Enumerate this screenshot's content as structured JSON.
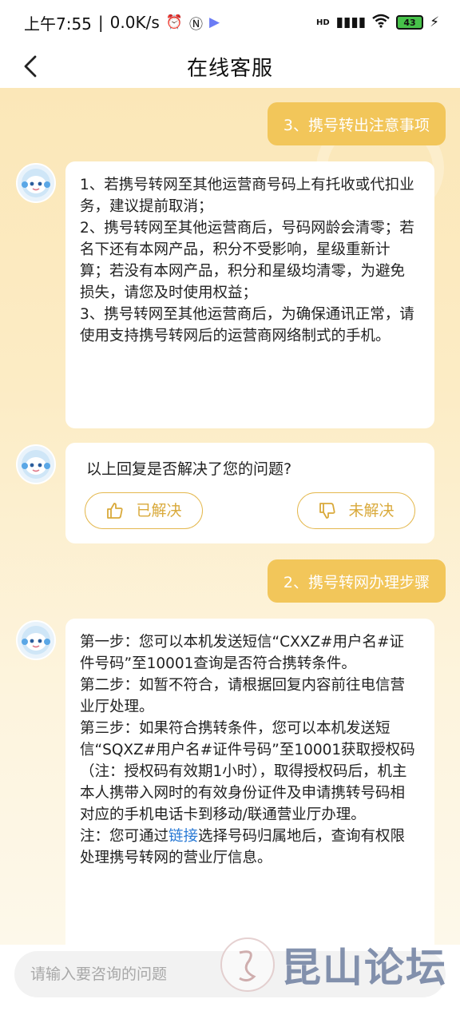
{
  "status_bar": {
    "time": "上午7:55",
    "net_speed": "0.0K/s",
    "battery": "43",
    "hd_label": "HD"
  },
  "header": {
    "title": "在线客服"
  },
  "messages": {
    "user_1": "3、携号转出注意事项",
    "bot_1": [
      "1、若携号转网至其他运营商号码上有托收或代扣业务，建议提前取消；",
      "2、携号转网至其他运营商后，号码网龄会清零；若名下还有本网产品，积分不受影响，星级重新计算；若没有本网产品，积分和星级均清零，为避免损失，请您及时使用权益；",
      "3、携号转网至其他运营商后，为确保通讯正常，请使用支持携号转网后的运营商网络制式的手机。"
    ],
    "feedback": {
      "question": "以上回复是否解决了您的问题?",
      "resolved": "已解决",
      "unresolved": "未解决"
    },
    "user_2": "2、携号转网办理步骤",
    "bot_2": {
      "step1": "第一步：您可以本机发送短信“CXXZ#用户名#证件号码”至10001查询是否符合携转条件。",
      "step2": "第二步：如暂不符合，请根据回复内容前往电信营业厅处理。",
      "step3": "第三步：如果符合携转条件，您可以本机发送短信“SQXZ#用户名#证件号码”至10001获取授权码（注：授权码有效期1小时），取得授权码后，机主本人携带入网时的有效身份证件及申请携转号码相对应的手机电话卡到移动/联通营业厅办理。",
      "note_prefix": "注：您可通过",
      "note_link": "链接",
      "note_suffix": "选择号码归属地后，查询有权限处理携号转网的营业厅信息。"
    }
  },
  "input": {
    "placeholder": "请输入要咨询的问题"
  },
  "watermark": {
    "text": "昆山论坛"
  },
  "colors": {
    "accent": "#f2c65a",
    "feedback_border": "#e4b84e",
    "link": "#2a7ad5",
    "chat_bg_top": "#fbe7b8"
  }
}
